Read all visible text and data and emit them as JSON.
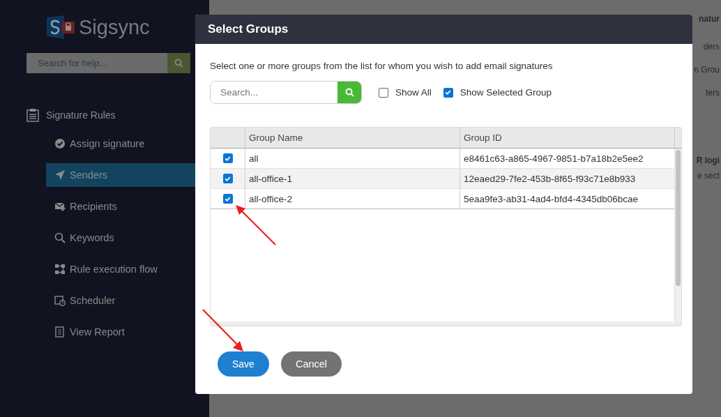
{
  "sidebar": {
    "logo": "Sigsync",
    "search": {
      "placeholder": "Search for help..."
    },
    "section": "Signature Rules",
    "items": [
      {
        "label": "Assign signature",
        "kind": "check",
        "selected": false
      },
      {
        "label": "Senders",
        "kind": "send",
        "selected": true
      },
      {
        "label": "Recipients",
        "kind": "mail",
        "selected": false
      },
      {
        "label": "Keywords",
        "kind": "search",
        "selected": false
      },
      {
        "label": "Rule execution flow",
        "kind": "flow",
        "selected": false
      },
      {
        "label": "Scheduler",
        "kind": "calendar",
        "selected": false
      },
      {
        "label": "View Report",
        "kind": "report",
        "selected": false
      }
    ]
  },
  "background_text": [
    {
      "text": "natur",
      "kind": "heading"
    },
    {
      "text": "ders",
      "kind": "link"
    },
    {
      "text": "n Grou",
      "kind": "link"
    },
    {
      "text": "ters",
      "kind": "link"
    },
    {
      "text": "R logi",
      "kind": "heading"
    },
    {
      "text": "e sect",
      "kind": "text"
    }
  ],
  "dialog": {
    "title": "Select Groups",
    "instruction": "Select one or more groups from the list for whom you wish to add email signatures",
    "search": {
      "placeholder": "Search..."
    },
    "options": [
      {
        "label": "Show All",
        "checked": false
      },
      {
        "label": "Show Selected Group",
        "checked": true
      }
    ],
    "table": {
      "columns": [
        "Group Name",
        "Group ID"
      ],
      "rows": [
        {
          "selected": true,
          "name": "all",
          "id": "e8461c63-a865-4967-9851-b7a18b2e5ee2"
        },
        {
          "selected": true,
          "name": "all-office-1",
          "id": "12eaed29-7fe2-453b-8f65-f93c71e8b933"
        },
        {
          "selected": true,
          "name": "all-office-2",
          "id": "5eaa9fe3-ab31-4ad4-bfd4-4345db06bcae"
        }
      ]
    },
    "buttons": [
      {
        "label": "Save",
        "kind": "primary"
      },
      {
        "label": "Cancel",
        "kind": "secondary"
      }
    ]
  }
}
